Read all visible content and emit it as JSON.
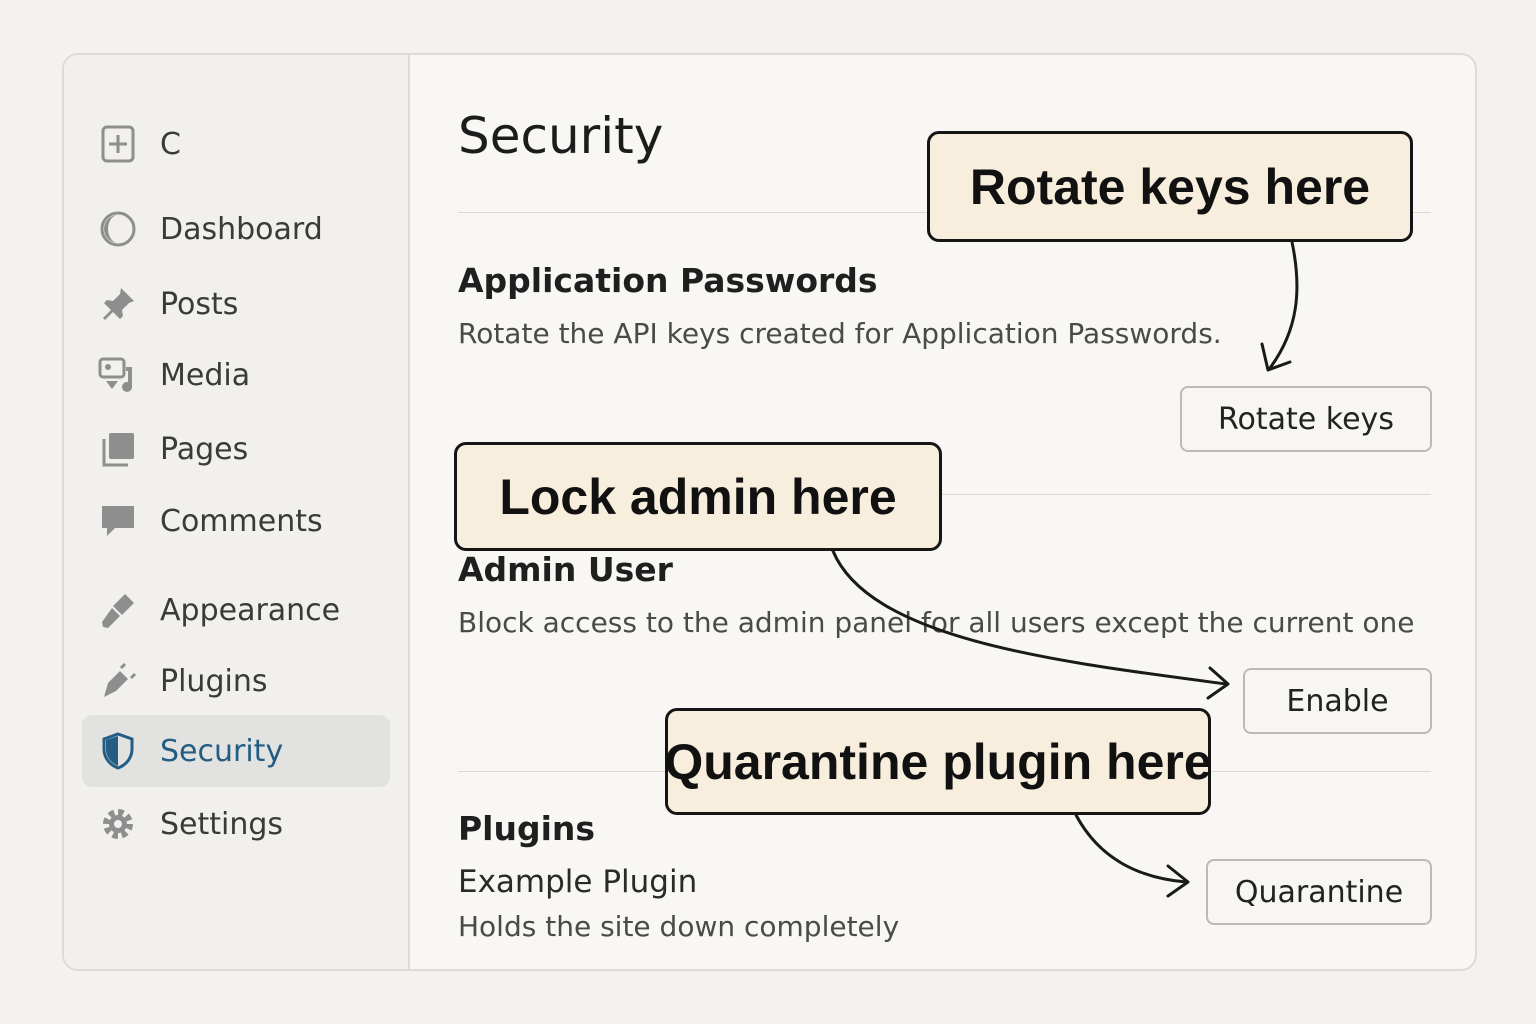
{
  "sidebar": {
    "items": [
      {
        "label": "C",
        "icon": "plus-square-icon"
      },
      {
        "label": "Dashboard",
        "icon": "dashboard-gauge-icon"
      },
      {
        "label": "Posts",
        "icon": "pushpin-icon"
      },
      {
        "label": "Media",
        "icon": "media-icon"
      },
      {
        "label": "Pages",
        "icon": "pages-icon"
      },
      {
        "label": "Comments",
        "icon": "speech-bubble-icon"
      },
      {
        "label": "Appearance",
        "icon": "paintbrush-icon"
      },
      {
        "label": "Plugins",
        "icon": "plug-icon"
      },
      {
        "label": "Security",
        "icon": "shield-icon",
        "active": true
      },
      {
        "label": "Settings",
        "icon": "gear-icon"
      }
    ]
  },
  "main": {
    "title": "Security",
    "app_passwords": {
      "title": "Application Passwords",
      "description": "Rotate the API keys created for Application Passwords.",
      "button": "Rotate keys"
    },
    "admin_user": {
      "title": "Admin User",
      "description": "Block access to the admin panel for all users except the current one",
      "button": "Enable"
    },
    "plugins": {
      "title": "Plugins",
      "plugin_name": "Example Plugin",
      "plugin_description": "Holds the site down completely",
      "button": "Quarantine"
    }
  },
  "callouts": {
    "rotate": "Rotate keys here",
    "lock": "Lock admin here",
    "quarantine": "Quarantine plugin here"
  },
  "colors": {
    "accent": "#235d84",
    "callout_bg": "#f8eedd",
    "active_bg": "#e2e2e0"
  }
}
